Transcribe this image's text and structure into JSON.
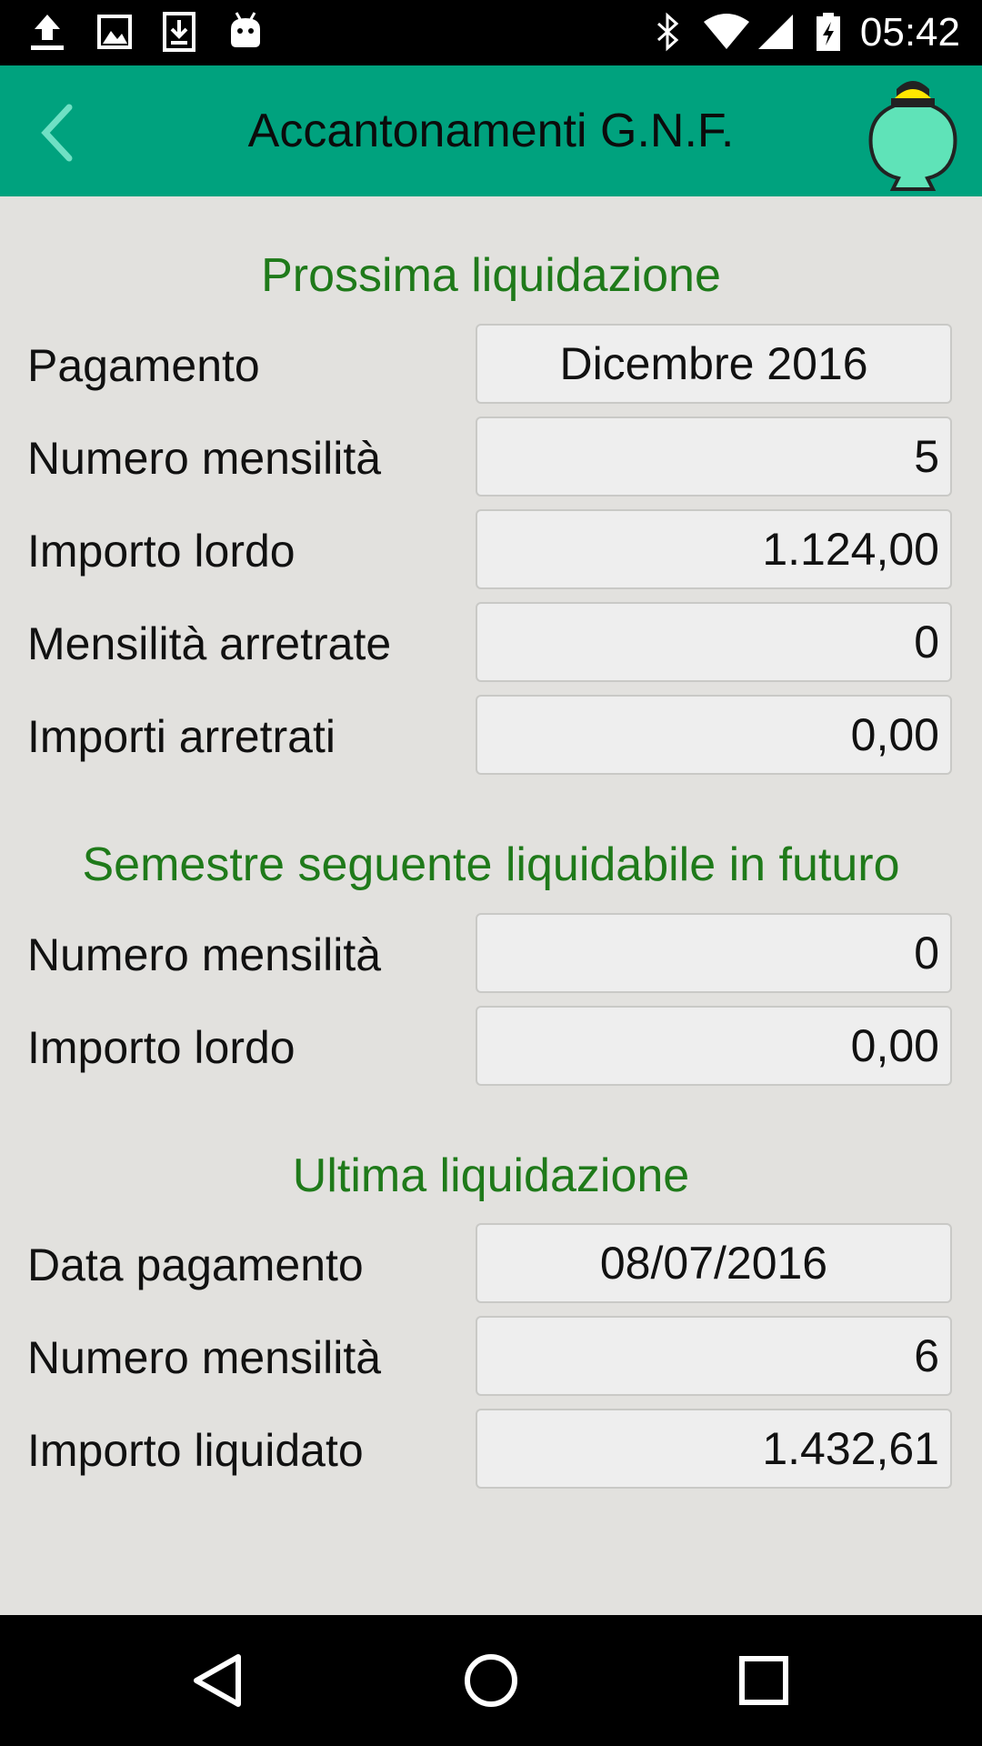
{
  "status_bar": {
    "time": "05:42",
    "left_icons": [
      "upload-icon",
      "image-icon",
      "download-icon",
      "android-debug-icon"
    ],
    "right_icons": [
      "bluetooth-icon",
      "wifi-icon",
      "signal-icon",
      "battery-charging-icon"
    ]
  },
  "app_bar": {
    "title": "Accantonamenti G.N.F.",
    "back_icon": "chevron-left-icon",
    "logo_icon": "piggy-bank-icon"
  },
  "sections": {
    "next": {
      "title": "Prossima liquidazione",
      "rows": [
        {
          "label": "Pagamento",
          "value": "Dicembre 2016"
        },
        {
          "label": "Numero mensilità",
          "value": "5"
        },
        {
          "label": "Importo lordo",
          "value": "1.124,00"
        },
        {
          "label": "Mensilità arretrate",
          "value": "0"
        },
        {
          "label": "Importi arretrati",
          "value": "0,00"
        }
      ]
    },
    "future": {
      "title": "Semestre seguente liquidabile in futuro",
      "rows": [
        {
          "label": "Numero mensilità",
          "value": "0"
        },
        {
          "label": "Importo lordo",
          "value": "0,00"
        }
      ]
    },
    "last": {
      "title": "Ultima liquidazione",
      "rows": [
        {
          "label": "Data pagamento",
          "value": "08/07/2016"
        },
        {
          "label": "Numero mensilità",
          "value": "6"
        },
        {
          "label": "Importo liquidato",
          "value": "1.432,61"
        }
      ]
    }
  },
  "nav_bar": {
    "icons": [
      "nav-back-icon",
      "nav-home-icon",
      "nav-recents-icon"
    ]
  },
  "colors": {
    "app_bar": "#00a27e",
    "section_title": "#1f7a1a",
    "background": "#e2e1de",
    "field_background": "#eeeeee"
  }
}
